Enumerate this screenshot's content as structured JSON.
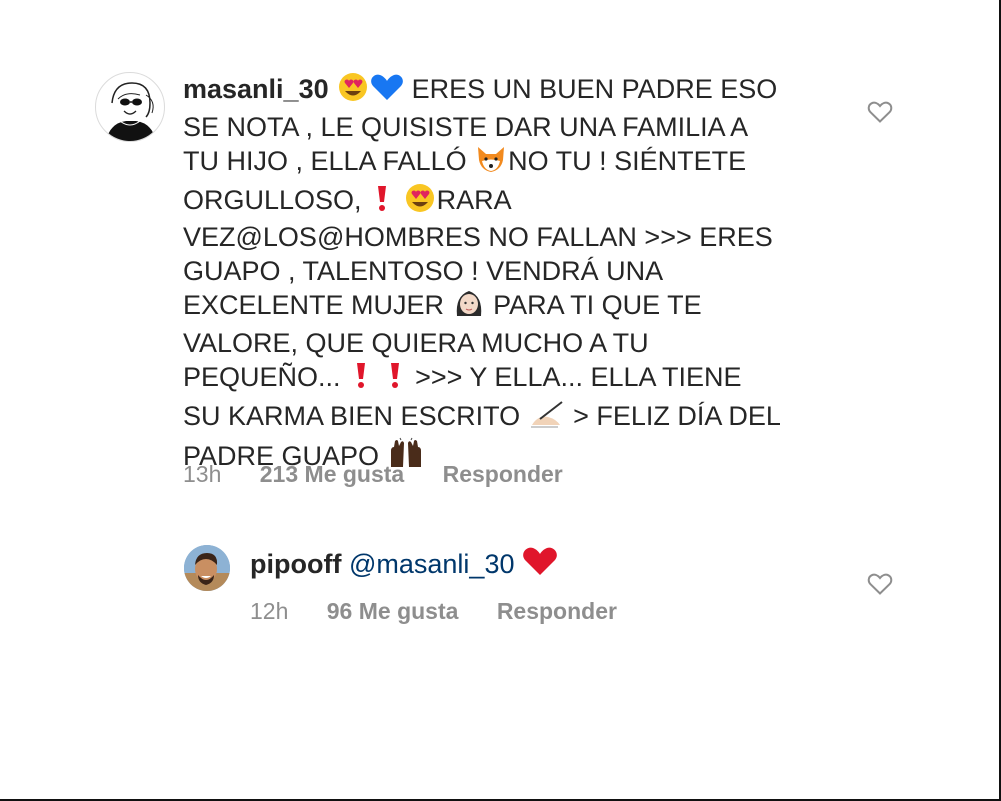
{
  "comment": {
    "username": "masanli_30",
    "lines": [
      "ERES UN BUEN PADRE ESO",
      "SE NOTA , LE QUISISTE DAR UNA FAMILIA A",
      "TU HIJO , ELLA FALLÓ",
      "NO TU ! SIÉNTETE",
      "ORGULLOSO,",
      "RARA",
      "VEZ@LOS@HOMBRES NO FALLAN >>> ERES",
      "GUAPO , TALENTOSO ! VENDRÁ UNA",
      "EXCELENTE MUJER",
      "PARA TI QUE TE",
      "VALORE, QUE QUIERA MUCHO A TU",
      "PEQUEÑO...",
      ">>> Y ELLA... ELLA TIENE",
      "SU KARMA BIEN ESCRITO",
      "> FELIZ DÍA DEL",
      "PADRE GUAPO"
    ],
    "time": "13h",
    "likes": "213 Me gusta",
    "reply": "Responder"
  },
  "reply": {
    "username": "pipooff",
    "mention": "@masanli_30",
    "time": "12h",
    "likes": "96 Me gusta",
    "reply": "Responder"
  },
  "icons": {
    "like": "heart-outline-icon",
    "emoji_heart_eyes": "heart-eyes-emoji",
    "emoji_blue_heart": "blue-heart-emoji",
    "emoji_fox": "fox-emoji",
    "emoji_exclamation": "red-exclamation-emoji",
    "emoji_woman": "woman-emoji",
    "emoji_writing_hand": "writing-hand-emoji",
    "emoji_raised_hands": "raised-hands-emoji",
    "emoji_red_heart": "red-heart-emoji"
  },
  "colors": {
    "text": "#262626",
    "secondary": "#8e8e8e",
    "mention": "#00376b"
  }
}
